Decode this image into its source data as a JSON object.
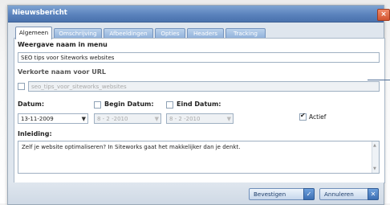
{
  "window": {
    "title": "Nieuwsbericht",
    "close_glyph": "×"
  },
  "tabs": [
    {
      "label": "Algemeen",
      "active": true
    },
    {
      "label": "Omschrijving",
      "active": false
    },
    {
      "label": "Afbeeldingen",
      "active": false
    },
    {
      "label": "Opties",
      "active": false
    },
    {
      "label": "Headers",
      "active": false
    },
    {
      "label": "Tracking",
      "active": false
    }
  ],
  "form": {
    "menu_name": {
      "label": "Weergave naam in menu",
      "value": "SEO tips voor Siteworks websites"
    },
    "url_name": {
      "label": "Verkorte naam voor URL",
      "value": "seo_tips_voor_siteworks_websites",
      "checked": false
    },
    "datum": {
      "label": "Datum:",
      "value": "13-11-2009",
      "arrow": "▼"
    },
    "begin_datum": {
      "label": "Begin Datum:",
      "value": "8 - 2 -2010",
      "checked": false,
      "arrow": "▼"
    },
    "eind_datum": {
      "label": "Eind Datum:",
      "value": "8 - 2 -2010",
      "checked": false,
      "arrow": "▼"
    },
    "actief": {
      "label": "Actief",
      "checked": true
    },
    "inleiding": {
      "label": "Inleiding:",
      "value": "Zelf je website optimaliseren? In Siteworks gaat het makkelijker dan je denkt."
    }
  },
  "buttons": {
    "confirm": {
      "label": "Bevestigen",
      "icon": "check-icon",
      "glyph": "✓"
    },
    "cancel": {
      "label": "Annuleren",
      "icon": "close-icon",
      "glyph": "✕"
    }
  },
  "colors": {
    "title_bar": "#5b83bd",
    "tab_inactive": "#8eb0da",
    "panel": "#ffffff",
    "dialog_bg": "#dfe6ee"
  }
}
